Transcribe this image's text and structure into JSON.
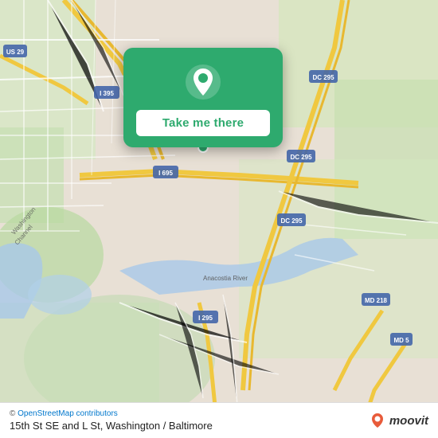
{
  "map": {
    "alt": "Map of Washington DC and Baltimore area"
  },
  "popup": {
    "take_me_there": "Take me there"
  },
  "bottom_bar": {
    "osm_credit": "© OpenStreetMap contributors",
    "location_label": "15th St SE and L St, Washington / Baltimore",
    "moovit_text": "moovit"
  }
}
